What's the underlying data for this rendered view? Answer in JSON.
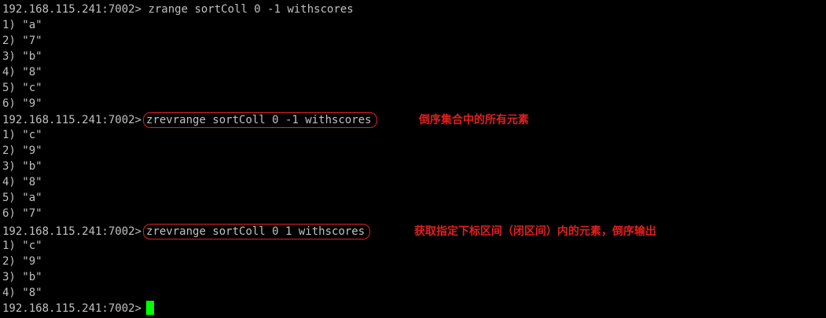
{
  "terminal": {
    "text_color": "#c0c0c0",
    "background_color": "#000000",
    "highlight_color": "#e02020",
    "cursor_color": "#00ff00",
    "prompt": "192.168.115.241:7002>",
    "block1": {
      "command": " zrange sortColl 0 -1 withscores",
      "results": [
        "1) \"a\"",
        "2) \"7\"",
        "3) \"b\"",
        "4) \"8\"",
        "5) \"c\"",
        "6) \"9\""
      ]
    },
    "block2": {
      "command": "zrevrange sortColl 0 -1 withscores",
      "annotation": "倒序集合中的所有元素",
      "results": [
        "1) \"c\"",
        "2) \"9\"",
        "3) \"b\"",
        "4) \"8\"",
        "5) \"a\"",
        "6) \"7\""
      ]
    },
    "block3": {
      "command": "zrevrange sortColl 0 1 withscores",
      "annotation": "获取指定下标区间（闭区间）内的元素，倒序输出",
      "results": [
        "1) \"c\"",
        "2) \"9\"",
        "3) \"b\"",
        "4) \"8\""
      ]
    }
  }
}
